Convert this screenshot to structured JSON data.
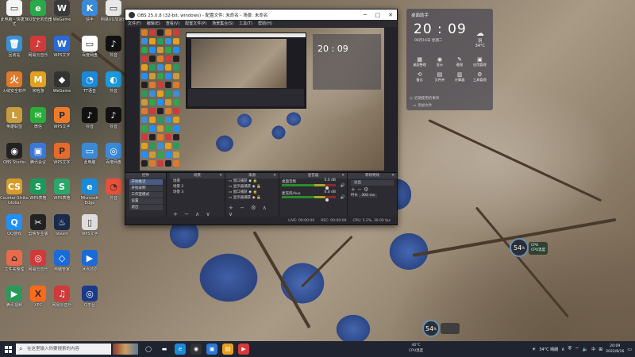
{
  "desktop_icons": [
    {
      "label": "此电脑 - 快捷方式",
      "color": "#f4f4f4",
      "glyph": "▭"
    },
    {
      "label": "回收站",
      "color": "#3a8fd8",
      "glyph": "🗑"
    },
    {
      "label": "火绒安全软件",
      "color": "#e07a2a",
      "glyph": "火"
    },
    {
      "label": "英雄联盟",
      "color": "#c89b3c",
      "glyph": "L"
    },
    {
      "label": "OBS Studio",
      "color": "#222",
      "glyph": "◉"
    },
    {
      "label": "Counter-Strike Global",
      "color": "#d89a2a",
      "glyph": "CS"
    },
    {
      "label": "QQ游戏",
      "color": "#1e90ff",
      "glyph": "Q"
    },
    {
      "label": "文件夹整理",
      "color": "#e86a4a",
      "glyph": "⌂"
    },
    {
      "label": "腾讯视频",
      "color": "#2a9a5a",
      "glyph": "▶"
    },
    {
      "label": "360安全浏览器",
      "color": "#2aa84a",
      "glyph": "e"
    },
    {
      "label": "网易云音乐",
      "color": "#d03a3a",
      "glyph": "♪"
    },
    {
      "label": "米哈游",
      "color": "#e0a020",
      "glyph": "M"
    },
    {
      "label": "微信",
      "color": "#2aae3a",
      "glyph": "✉"
    },
    {
      "label": "腾讯会议",
      "color": "#3a78d8",
      "glyph": "▣"
    },
    {
      "label": "WPS表格",
      "color": "#1a9a5a",
      "glyph": "S"
    },
    {
      "label": "剪映专业版",
      "color": "#222",
      "glyph": "✂"
    },
    {
      "label": "网易云音乐",
      "color": "#d03a3a",
      "glyph": "◎"
    },
    {
      "label": "XPC",
      "color": "#ff6a1a",
      "glyph": "X"
    },
    {
      "label": "WeGame",
      "color": "#3a3a3a",
      "glyph": "W"
    },
    {
      "label": "WPS文字",
      "color": "#2a6ad8",
      "glyph": "W"
    },
    {
      "label": "WeGame",
      "color": "#333",
      "glyph": "◆"
    },
    {
      "label": "WPS文字",
      "color": "#f07a2a",
      "glyph": "P"
    },
    {
      "label": "WPS文字",
      "color": "#e86a2a",
      "glyph": "P"
    },
    {
      "label": "WPS表格",
      "color": "#2aa86a",
      "glyph": "S"
    },
    {
      "label": "Steam",
      "color": "#1a2a4a",
      "glyph": "♨"
    },
    {
      "label": "电脑管家",
      "color": "#1a6ad8",
      "glyph": "◇"
    },
    {
      "label": "网易云音乐",
      "color": "#d03a3a",
      "glyph": "♫"
    },
    {
      "label": "快手",
      "color": "#3a8ad8",
      "glyph": "K"
    },
    {
      "label": "百度网盘",
      "color": "#fff",
      "glyph": "▭"
    },
    {
      "label": "TT语音",
      "color": "#1a8ad8",
      "glyph": "◔"
    },
    {
      "label": "抖音",
      "color": "#111",
      "glyph": "♪"
    },
    {
      "label": "此电脑",
      "color": "#3a8ad8",
      "glyph": "▭"
    },
    {
      "label": "Microsoft Edge",
      "color": "#1a8ad8",
      "glyph": "e"
    },
    {
      "label": "WPS文字",
      "color": "#ddd",
      "glyph": "▯"
    },
    {
      "label": "冰点还原",
      "color": "#1a6ad8",
      "glyph": "▶"
    },
    {
      "label": "Q平台",
      "color": "#1a3a8a",
      "glyph": "◎"
    },
    {
      "label": "网易UU加速器",
      "color": "#e8e8e8",
      "glyph": "▭"
    },
    {
      "label": "抖音",
      "color": "#111",
      "glyph": "♪"
    },
    {
      "label": "抖音",
      "color": "#1a9ad8",
      "glyph": "◐"
    },
    {
      "label": "抖音",
      "color": "#111",
      "glyph": "♪"
    },
    {
      "label": "百度网盘",
      "color": "#3a8ad8",
      "glyph": "◎"
    },
    {
      "label": "抖音",
      "color": "#e8503a",
      "glyph": "◔"
    }
  ],
  "obs": {
    "title": "OBS 25.0.8 (32-bit, windows) - 配置文件: 未命名 - 场景: 未命名",
    "menu": [
      "文件(F)",
      "编辑(E)",
      "查看(V)",
      "配置文件(P)",
      "场景集合(S)",
      "工具(T)",
      "帮助(H)"
    ],
    "docks": {
      "scenes": {
        "title": "场景",
        "items": [
          "场景"
        ]
      },
      "sources": {
        "title": "来源",
        "items": [
          "场景",
          "场景 2",
          "场景 3"
        ]
      },
      "audio": {
        "title": "来源",
        "items": [
          "窗口捕获",
          "显示器捕获",
          "窗口捕获",
          "显示器捕获"
        ]
      },
      "mixer": {
        "title": "混音器",
        "rows": [
          {
            "name": "桌面音频",
            "db": "0.0 dB"
          },
          {
            "name": "麦克风/Aux",
            "db": "0.0 dB"
          }
        ]
      },
      "transitions": {
        "title": "转场特效",
        "type": "淡出",
        "duration_label": "时长",
        "duration": "300 ms"
      },
      "controls": {
        "title": "控件",
        "buttons": [
          "开始推流",
          "开始录制",
          "工作室模式",
          "设置",
          "退出"
        ]
      }
    },
    "status": [
      "LIVE: 00:00:00",
      "REC: 00:00:00",
      "CPU: 5.2%, 30.00 fps"
    ]
  },
  "clock_widget": {
    "header": "桌面助手",
    "time": "20 : 09",
    "date": "08月16日  星期二",
    "weather": "阴",
    "temp": "34°C",
    "grid": [
      {
        "label": "桌面整理",
        "icon": "▦"
      },
      {
        "label": "显示",
        "icon": "◉"
      },
      {
        "label": "截图",
        "icon": "✎"
      },
      {
        "label": "应用管理",
        "icon": "▣"
      },
      {
        "label": "备忘",
        "icon": "⟲"
      },
      {
        "label": "文件夹",
        "icon": "▤"
      },
      {
        "label": "计算器",
        "icon": "▥"
      },
      {
        "label": "工具管理",
        "icon": "⚙"
      }
    ],
    "recent": "近期使用的事项",
    "recent2": "添加文件"
  },
  "cpu_gadget": {
    "value": "54",
    "unit": "%",
    "label1": "CPU",
    "label2": "CPU温度"
  },
  "cpu_gadget2": {
    "value": "54",
    "unit": "%"
  },
  "taskbar": {
    "search_placeholder": "在这里输入你要搜索的内容",
    "center_line1": "40°C",
    "center_line2": "CPU温度",
    "weather": "34°C  晴朗",
    "time": "20:09",
    "date": "2022/8/16",
    "lang": "中"
  }
}
